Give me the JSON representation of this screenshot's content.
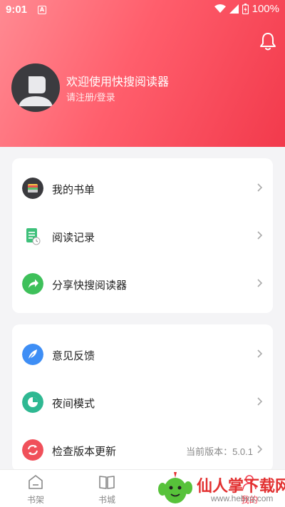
{
  "status_bar": {
    "time": "9:01",
    "notification_badge": "A",
    "battery": "100%"
  },
  "profile": {
    "welcome": "欢迎使用快搜阅读器",
    "login_prompt": "请注册/登录"
  },
  "menu_group_1": [
    {
      "label": "我的书单",
      "icon": "wallet-icon",
      "color": "#3a3a3e"
    },
    {
      "label": "阅读记录",
      "icon": "document-icon",
      "color": "#3ec07a"
    },
    {
      "label": "分享快搜阅读器",
      "icon": "share-icon",
      "color": "#3ec05a"
    }
  ],
  "menu_group_2": [
    {
      "label": "意见反馈",
      "icon": "feather-icon",
      "color": "#3e8ef5"
    },
    {
      "label": "夜间模式",
      "icon": "pie-chart-icon",
      "color": "#2fb892"
    },
    {
      "label": "检查版本更新",
      "icon": "refresh-icon",
      "color": "#f0505a",
      "extra": "当前版本：5.0.1"
    }
  ],
  "tabs": [
    {
      "label": "书架",
      "icon": "bookshelf-icon"
    },
    {
      "label": "书城",
      "icon": "book-icon"
    },
    {
      "label": "我的",
      "icon": "user-icon"
    }
  ],
  "watermark": {
    "text": "仙人掌下载网",
    "url": "www.hebxq.com"
  },
  "colors": {
    "header_start": "#ff8a92",
    "header_end": "#f23a4c",
    "page_bg": "#f4f4f6"
  }
}
